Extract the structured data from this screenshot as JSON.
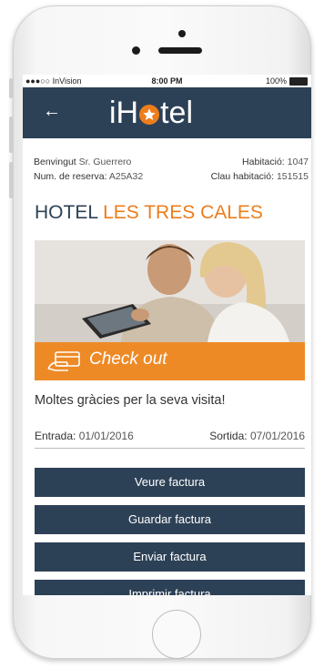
{
  "status_bar": {
    "carrier": "●●●○○ InVision",
    "time": "8:00 PM",
    "battery": "100%"
  },
  "navbar": {
    "back_glyph": "←",
    "logo_prefix": "iH",
    "logo_suffix": "tel"
  },
  "guest": {
    "welcome_label": "Benvingut",
    "welcome_name": "Sr. Guerrero",
    "room_label": "Habitació:",
    "room_value": "1047",
    "reservation_label": "Num. de reserva:",
    "reservation_value": "A25A32",
    "key_label": "Clau habitació:",
    "key_value": "151515"
  },
  "hotel": {
    "name_prefix": "HOTEL",
    "name_accent": "LES TRES CALES"
  },
  "checkout": {
    "label": "Check out"
  },
  "message": "Moltes gràcies per la seva visita!",
  "stay": {
    "entry_label": "Entrada:",
    "entry_value": "01/01/2016",
    "exit_label": "Sortida:",
    "exit_value": "07/01/2016"
  },
  "actions": [
    "Veure factura",
    "Guardar factura",
    "Enviar factura",
    "Imprimir factura"
  ],
  "colors": {
    "navy": "#2d4156",
    "orange": "#ee7d1c"
  }
}
